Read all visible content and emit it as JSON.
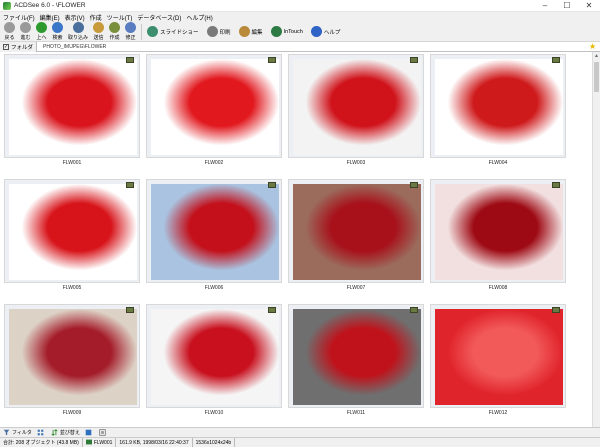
{
  "window": {
    "title": "ACDSee 6.0 - \\FLOWER",
    "min": "–",
    "max": "☐",
    "close": "✕"
  },
  "menu": [
    "ファイル(F)",
    "編集(E)",
    "表示(V)",
    "作成",
    "ツール(T)",
    "データベース(D)",
    "ヘルプ(H)"
  ],
  "toolbar": {
    "small": [
      {
        "label": "戻る",
        "color": "#9a9a9a"
      },
      {
        "label": "進む",
        "color": "#9a9a9a"
      },
      {
        "label": "上へ",
        "color": "#2e9a2e"
      },
      {
        "label": "検索",
        "color": "#3a77c8"
      },
      {
        "label": "取り込み",
        "color": "#4a6f9c"
      },
      {
        "label": "送信",
        "color": "#c89a3a"
      },
      {
        "label": "作成",
        "color": "#7a8f3c"
      },
      {
        "label": "修正",
        "color": "#5a7cc0"
      }
    ],
    "wide": [
      {
        "label": "スライドショー",
        "color": "#3c8e6f"
      },
      {
        "label": "印刷",
        "color": "#7a7a7a"
      },
      {
        "label": "編集",
        "color": "#b88a3a"
      },
      {
        "label": "InTouch",
        "color": "#2d7a45"
      },
      {
        "label": "ヘルプ",
        "color": "#2f63c5"
      }
    ]
  },
  "address": {
    "folder_tab": "フォルダ",
    "path": "PHOTO_IM\\JPEG\\FLOWER"
  },
  "thumbnails": [
    {
      "name": "FLW001",
      "bg": "#ffffff",
      "fg": "#d9141c"
    },
    {
      "name": "FLW002",
      "bg": "#ffffff",
      "fg": "#e1191f"
    },
    {
      "name": "FLW003",
      "bg": "#f3f3f3",
      "fg": "#d0121a"
    },
    {
      "name": "FLW004",
      "bg": "#ffffff",
      "fg": "#cf1a1c"
    },
    {
      "name": "FLW005",
      "bg": "#ffffff",
      "fg": "#d7141a"
    },
    {
      "name": "FLW006",
      "bg": "#a9c3e0",
      "fg": "#c3101b"
    },
    {
      "name": "FLW007",
      "bg": "#9b6b5c",
      "fg": "#a8101a"
    },
    {
      "name": "FLW008",
      "bg": "#f2e0e0",
      "fg": "#9e0a14"
    },
    {
      "name": "FLW009",
      "bg": "#ddd2c6",
      "fg": "#a41c2a"
    },
    {
      "name": "FLW010",
      "bg": "#f5f5f5",
      "fg": "#c8101e"
    },
    {
      "name": "FLW011",
      "bg": "#6f6f6f",
      "fg": "#c0121b"
    },
    {
      "name": "FLW012",
      "bg": "#e0242c",
      "fg": "#f25a5a"
    }
  ],
  "tools_bar": {
    "filter": "フィルタ",
    "sort": "並び替え"
  },
  "status": {
    "total": "合計: 208 オブジェクト (43.8 MB)",
    "file": "FLW001",
    "info": "161.9 KB, 1998/03/16 22:40:37",
    "dims": "1536x1024x24b"
  }
}
